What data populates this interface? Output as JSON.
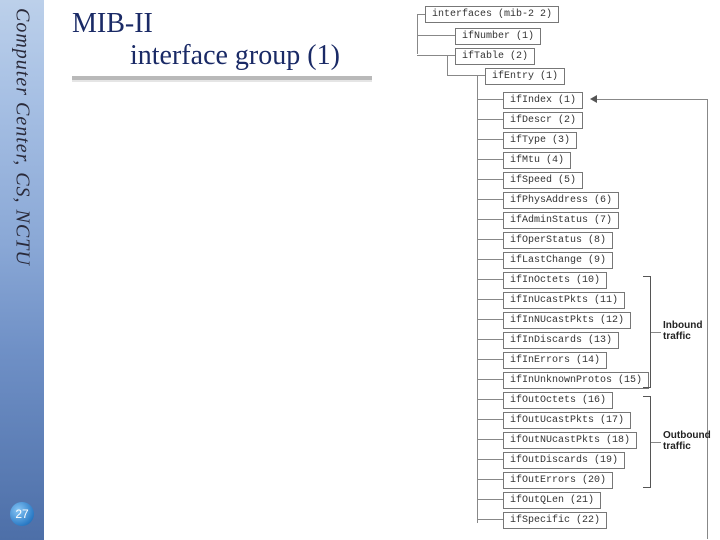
{
  "sidebar": {
    "org": "Computer Center, CS, NCTU",
    "page_number": "27"
  },
  "title": {
    "line1": "MIB-II",
    "line2": "interface group (1)"
  },
  "tree": {
    "root": {
      "label": "interfaces (mib-2 2)"
    },
    "ifnum": {
      "label": "ifNumber (1)"
    },
    "iftable": {
      "label": "ifTable (2)"
    },
    "ifentry": {
      "label": "ifEntry (1)"
    },
    "leaves": [
      {
        "label": "ifIndex (1)"
      },
      {
        "label": "ifDescr (2)"
      },
      {
        "label": "ifType (3)"
      },
      {
        "label": "ifMtu (4)"
      },
      {
        "label": "ifSpeed (5)"
      },
      {
        "label": "ifPhysAddress (6)"
      },
      {
        "label": "ifAdminStatus (7)"
      },
      {
        "label": "ifOperStatus (8)"
      },
      {
        "label": "ifLastChange (9)"
      },
      {
        "label": "ifInOctets (10)"
      },
      {
        "label": "ifInUcastPkts (11)"
      },
      {
        "label": "ifInNUcastPkts (12)"
      },
      {
        "label": "ifInDiscards (13)"
      },
      {
        "label": "ifInErrors (14)"
      },
      {
        "label": "ifInUnknownProtos (15)"
      },
      {
        "label": "ifOutOctets (16)"
      },
      {
        "label": "ifOutUcastPkts (17)"
      },
      {
        "label": "ifOutNUcastPkts (18)"
      },
      {
        "label": "ifOutDiscards (19)"
      },
      {
        "label": "ifOutErrors (20)"
      },
      {
        "label": "ifOutQLen (21)"
      },
      {
        "label": "ifSpecific (22)"
      }
    ]
  },
  "groups": {
    "inbound": {
      "label": "Inbound traffic"
    },
    "outbound": {
      "label": "Outbound traffic"
    }
  }
}
